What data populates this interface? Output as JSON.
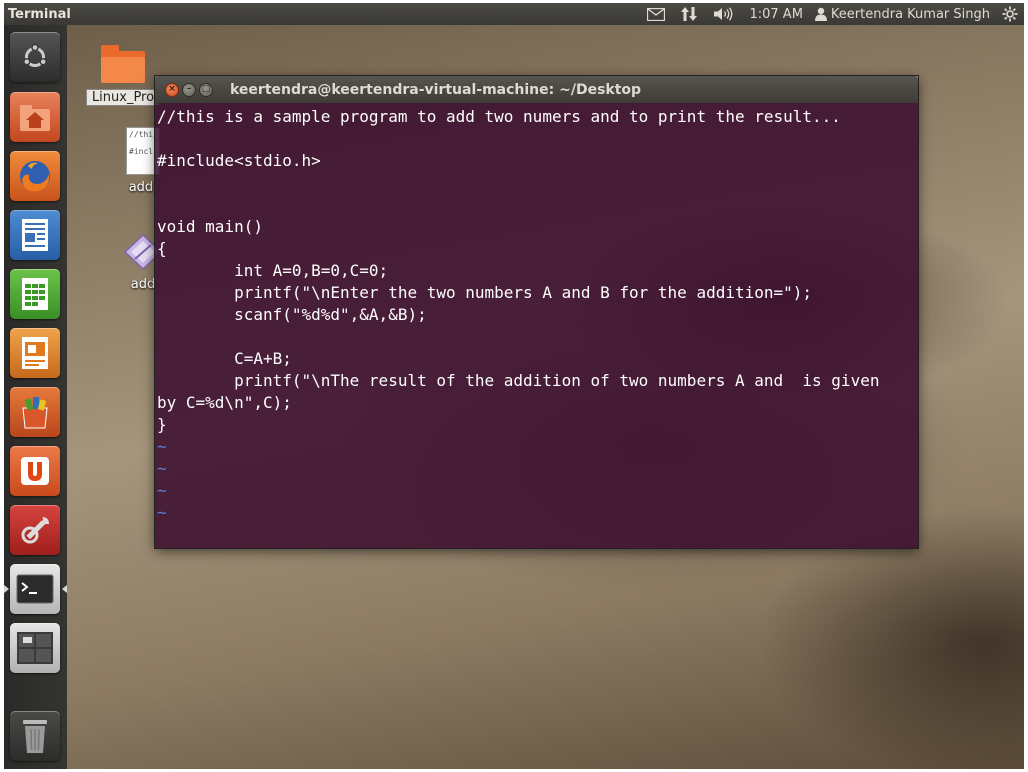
{
  "top_panel": {
    "app_title": "Terminal",
    "clock": "1:07 AM",
    "user_name": "Keertendra Kumar Singh",
    "icons": [
      "mail-icon",
      "network-icon",
      "volume-icon",
      "user-icon",
      "gear-icon"
    ]
  },
  "launcher": {
    "items": [
      "dash-home",
      "files",
      "firefox",
      "writer",
      "calc",
      "impress",
      "software-center",
      "ubuntu-one",
      "system-settings",
      "terminal",
      "workspaces",
      "trash"
    ]
  },
  "desktop": {
    "icons": [
      {
        "label": "Linux_Pro",
        "type": "folder"
      },
      {
        "label": "add.",
        "type": "text-file",
        "thumb_lines": [
          "//thi",
          "#incl"
        ]
      },
      {
        "label": "add",
        "type": "executable"
      }
    ]
  },
  "terminal": {
    "title": "keertendra@keertendra-virtual-machine: ~/Desktop",
    "lines": [
      "//this is a sample program to add two numers and to print the result...",
      "",
      "#include<stdio.h>",
      "",
      "",
      "void main()",
      "{",
      "        int A=0,B=0,C=0;",
      "        printf(\"\\nEnter the two numbers A and B for the addition=\");",
      "        scanf(\"%d%d\",&A,&B);",
      "",
      "        C=A+B;",
      "        printf(\"\\nThe result of the addition of two numbers A and  is given",
      "by C=%d\\n\",C);",
      "}",
      "~",
      "~",
      "~",
      "~"
    ]
  },
  "colors": {
    "terminal_bg": "#3a0c2e",
    "panel_bg": "#3c3b37",
    "tilde": "#5e7fd6",
    "close_button": "#e0582c"
  }
}
